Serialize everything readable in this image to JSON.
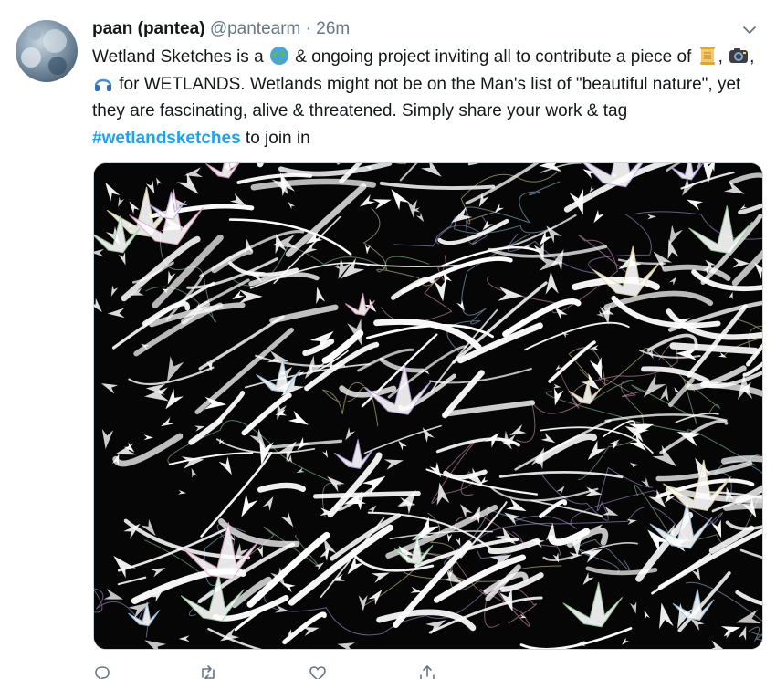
{
  "tweet": {
    "display_name": "paan (pantea)",
    "handle": "@pantearm",
    "separator": "·",
    "time": "26m",
    "text": {
      "p1": "Wetland Sketches is a ",
      "p2": " & ongoing project inviting all to contribute a piece of ",
      "p3": ", ",
      "p4": ", ",
      "p5": " for WETLANDS. Wetlands might not be on the Man's list of \"beautiful nature\", yet they are fascinating, alive & threatened. Simply share your work & tag ",
      "hashtag": "#wetlandsketches",
      "p6": " to join in"
    },
    "emojis": [
      "globe-icon",
      "scroll-icon",
      "camera-icon",
      "headphones-icon"
    ],
    "media": {
      "background_color": "#060606",
      "stroke_color": "#ffffff"
    },
    "actions": {
      "reply_count": "",
      "retweet_count": "",
      "like_count": ""
    }
  },
  "colors": {
    "link": "#1da1f2",
    "secondary": "#657786",
    "text": "#14171a"
  }
}
